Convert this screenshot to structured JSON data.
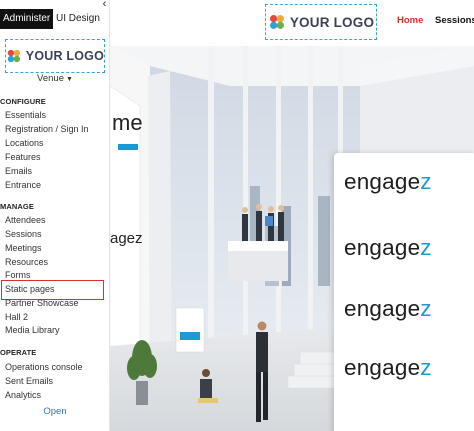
{
  "tabs": {
    "administer": "Administer",
    "ui_design": "UI Design",
    "collapse_icon": "chevron-left-icon"
  },
  "logo": {
    "text": "YOUR LOGO",
    "colors": [
      "#e8483b",
      "#f2a93b",
      "#2e9fd9",
      "#6ab04c"
    ]
  },
  "venue_selector": {
    "label": "Venue"
  },
  "sections": {
    "configure": {
      "title": "CONFIGURE",
      "items": [
        "Essentials",
        "Registration / Sign In",
        "Locations",
        "Features",
        "Emails",
        "Entrance"
      ]
    },
    "manage": {
      "title": "MANAGE",
      "items": [
        "Attendees",
        "Sessions",
        "Meetings",
        "Resources",
        "Forms",
        "Static pages",
        "Partner Showcase",
        "Hall 2",
        "Media Library"
      ]
    },
    "operate": {
      "title": "OPERATE",
      "items": [
        "Operations console",
        "Sent Emails",
        "Analytics"
      ]
    }
  },
  "open_label": "Open",
  "header": {
    "logo_text": "YOUR LOGO",
    "nav": {
      "home": "Home",
      "sessions": "Sessions"
    },
    "home_color": "#d9302c"
  },
  "scene": {
    "screen_text_top": "me",
    "screen_text_mid": "agez",
    "panel_brand": {
      "prefix": "engage",
      "suffix": "z",
      "accent": "#1e97d3",
      "repeats": 4
    }
  },
  "highlight_color": "#d9302c"
}
